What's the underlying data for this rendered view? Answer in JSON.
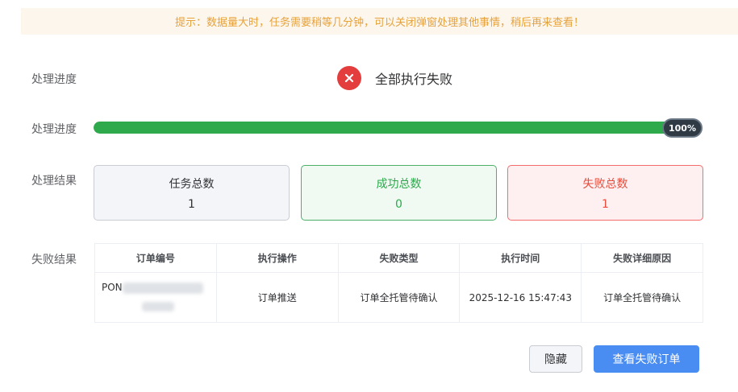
{
  "notice": {
    "text": "提示：数据量大时，任务需要稍等几分钟，可以关闭弹窗处理其他事情，稍后再来查看！"
  },
  "labels": {
    "status": "处理进度",
    "progress": "处理进度",
    "result": "处理结果",
    "failures": "失败结果"
  },
  "status": {
    "icon": "close-icon",
    "text": "全部执行失败",
    "color": "#e33d3d"
  },
  "progress": {
    "value": 100,
    "label": "100%",
    "color": "#2ea94c"
  },
  "stats": {
    "total": {
      "label": "任务总数",
      "value": "1"
    },
    "success": {
      "label": "成功总数",
      "value": "0"
    },
    "fail": {
      "label": "失败总数",
      "value": "1"
    }
  },
  "table": {
    "columns": [
      "订单编号",
      "执行操作",
      "失败类型",
      "执行时间",
      "失败详细原因"
    ],
    "rows": [
      {
        "order_no": "PON",
        "operation": "订单推送",
        "fail_type": "订单全托管待确认",
        "time": "2025-12-16 15:47:43",
        "reason": "订单全托管待确认"
      }
    ]
  },
  "buttons": {
    "hide": "隐藏",
    "view_failed": "查看失败订单"
  }
}
